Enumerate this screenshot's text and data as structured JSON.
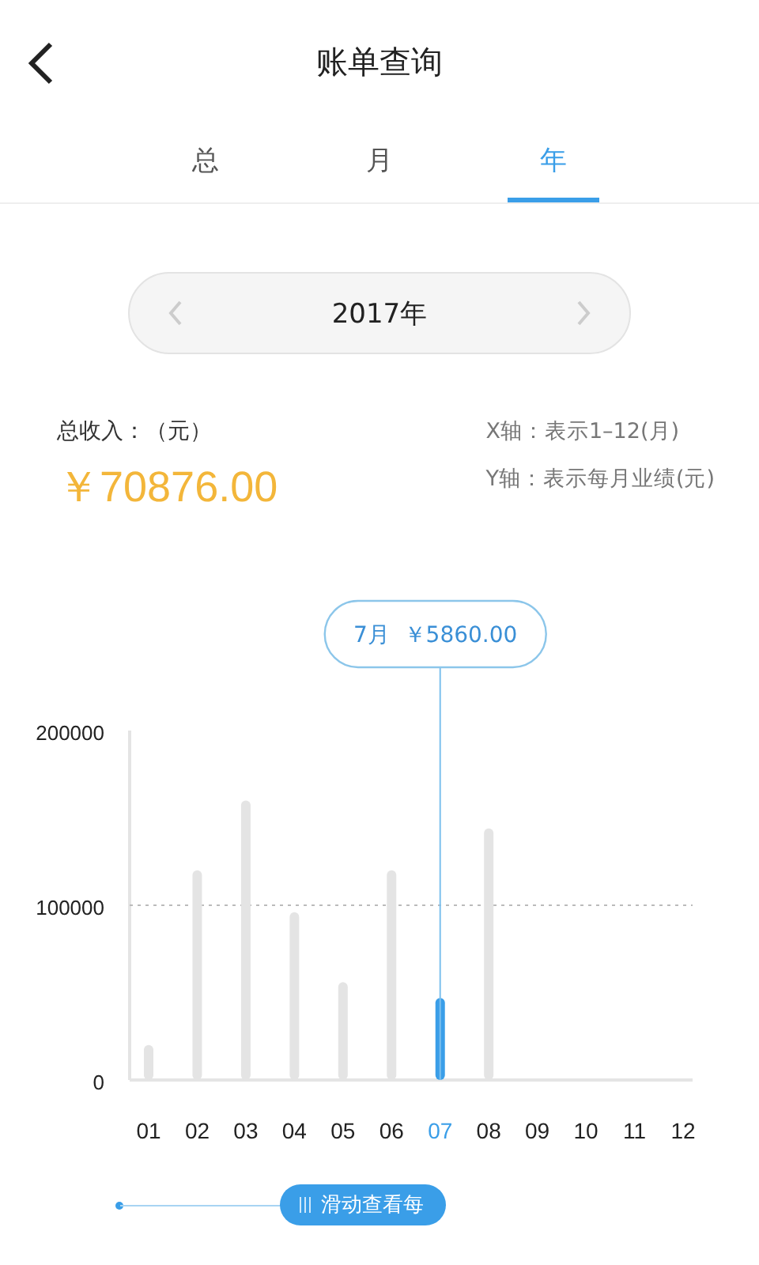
{
  "header": {
    "title": "账单查询"
  },
  "tabs": [
    {
      "label": "总",
      "selected": false
    },
    {
      "label": "月",
      "selected": false
    },
    {
      "label": "年",
      "selected": true
    }
  ],
  "year_selector": {
    "value": "2017年"
  },
  "summary": {
    "label": "总收入：（元）",
    "amount": "￥70876.00",
    "x_axis_note": "X轴：表示1–12(月)",
    "y_axis_note": "Y轴：表示每月业绩(元)"
  },
  "chart": {
    "chart_data": {
      "type": "bar",
      "categories": [
        "01",
        "02",
        "03",
        "04",
        "05",
        "06",
        "07",
        "08",
        "09",
        "10",
        "11",
        "12"
      ],
      "values": [
        20000,
        120000,
        160000,
        96000,
        56000,
        120000,
        47000,
        144000,
        null,
        null,
        null,
        null
      ],
      "ylim": [
        0,
        200000
      ],
      "yticks": [
        0,
        100000,
        200000
      ],
      "ref_lines": [
        {
          "axis": "y",
          "value": 100000
        }
      ],
      "annotations": [
        {
          "x": "07",
          "text": "7月  ￥5860.00"
        }
      ]
    }
  },
  "slider_hint": {
    "label": "滑动查看每"
  }
}
